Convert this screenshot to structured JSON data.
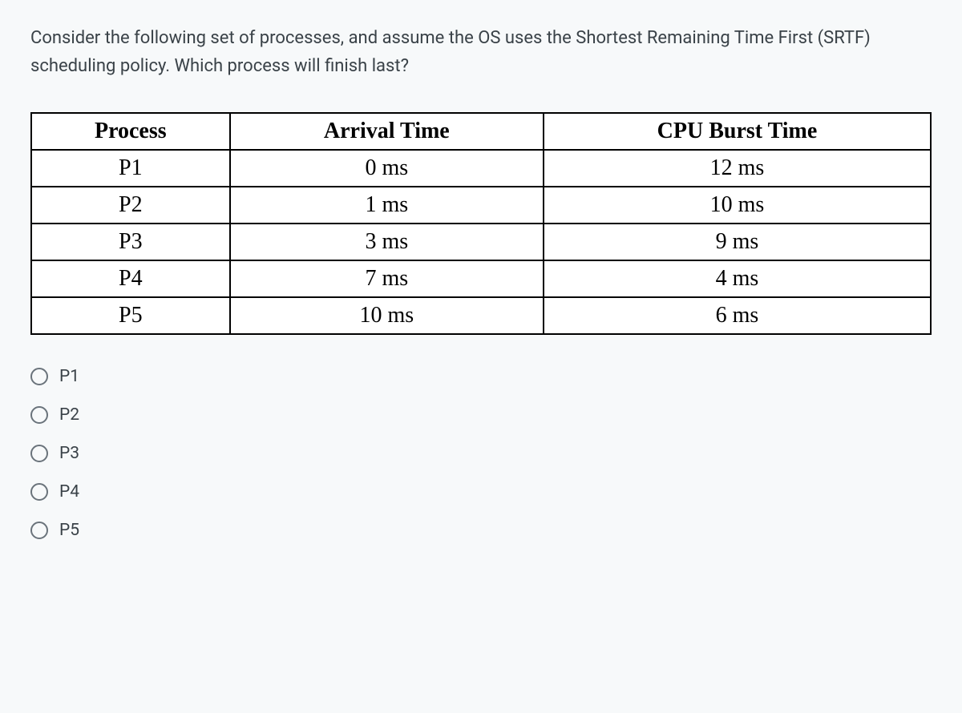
{
  "question": "Consider the following set of processes, and assume the OS uses the Shortest Remaining Time First (SRTF) scheduling policy. Which process will finish last?",
  "table": {
    "headers": [
      "Process",
      "Arrival Time",
      "CPU Burst Time"
    ],
    "rows": [
      {
        "process": "P1",
        "arrival": "0 ms",
        "burst": "12 ms"
      },
      {
        "process": "P2",
        "arrival": "1 ms",
        "burst": "10 ms"
      },
      {
        "process": "P3",
        "arrival": "3 ms",
        "burst": "9 ms"
      },
      {
        "process": "P4",
        "arrival": "7 ms",
        "burst": "4 ms"
      },
      {
        "process": "P5",
        "arrival": "10 ms",
        "burst": "6 ms"
      }
    ]
  },
  "options": [
    {
      "label": "P1"
    },
    {
      "label": "P2"
    },
    {
      "label": "P3"
    },
    {
      "label": "P4"
    },
    {
      "label": "P5"
    }
  ]
}
